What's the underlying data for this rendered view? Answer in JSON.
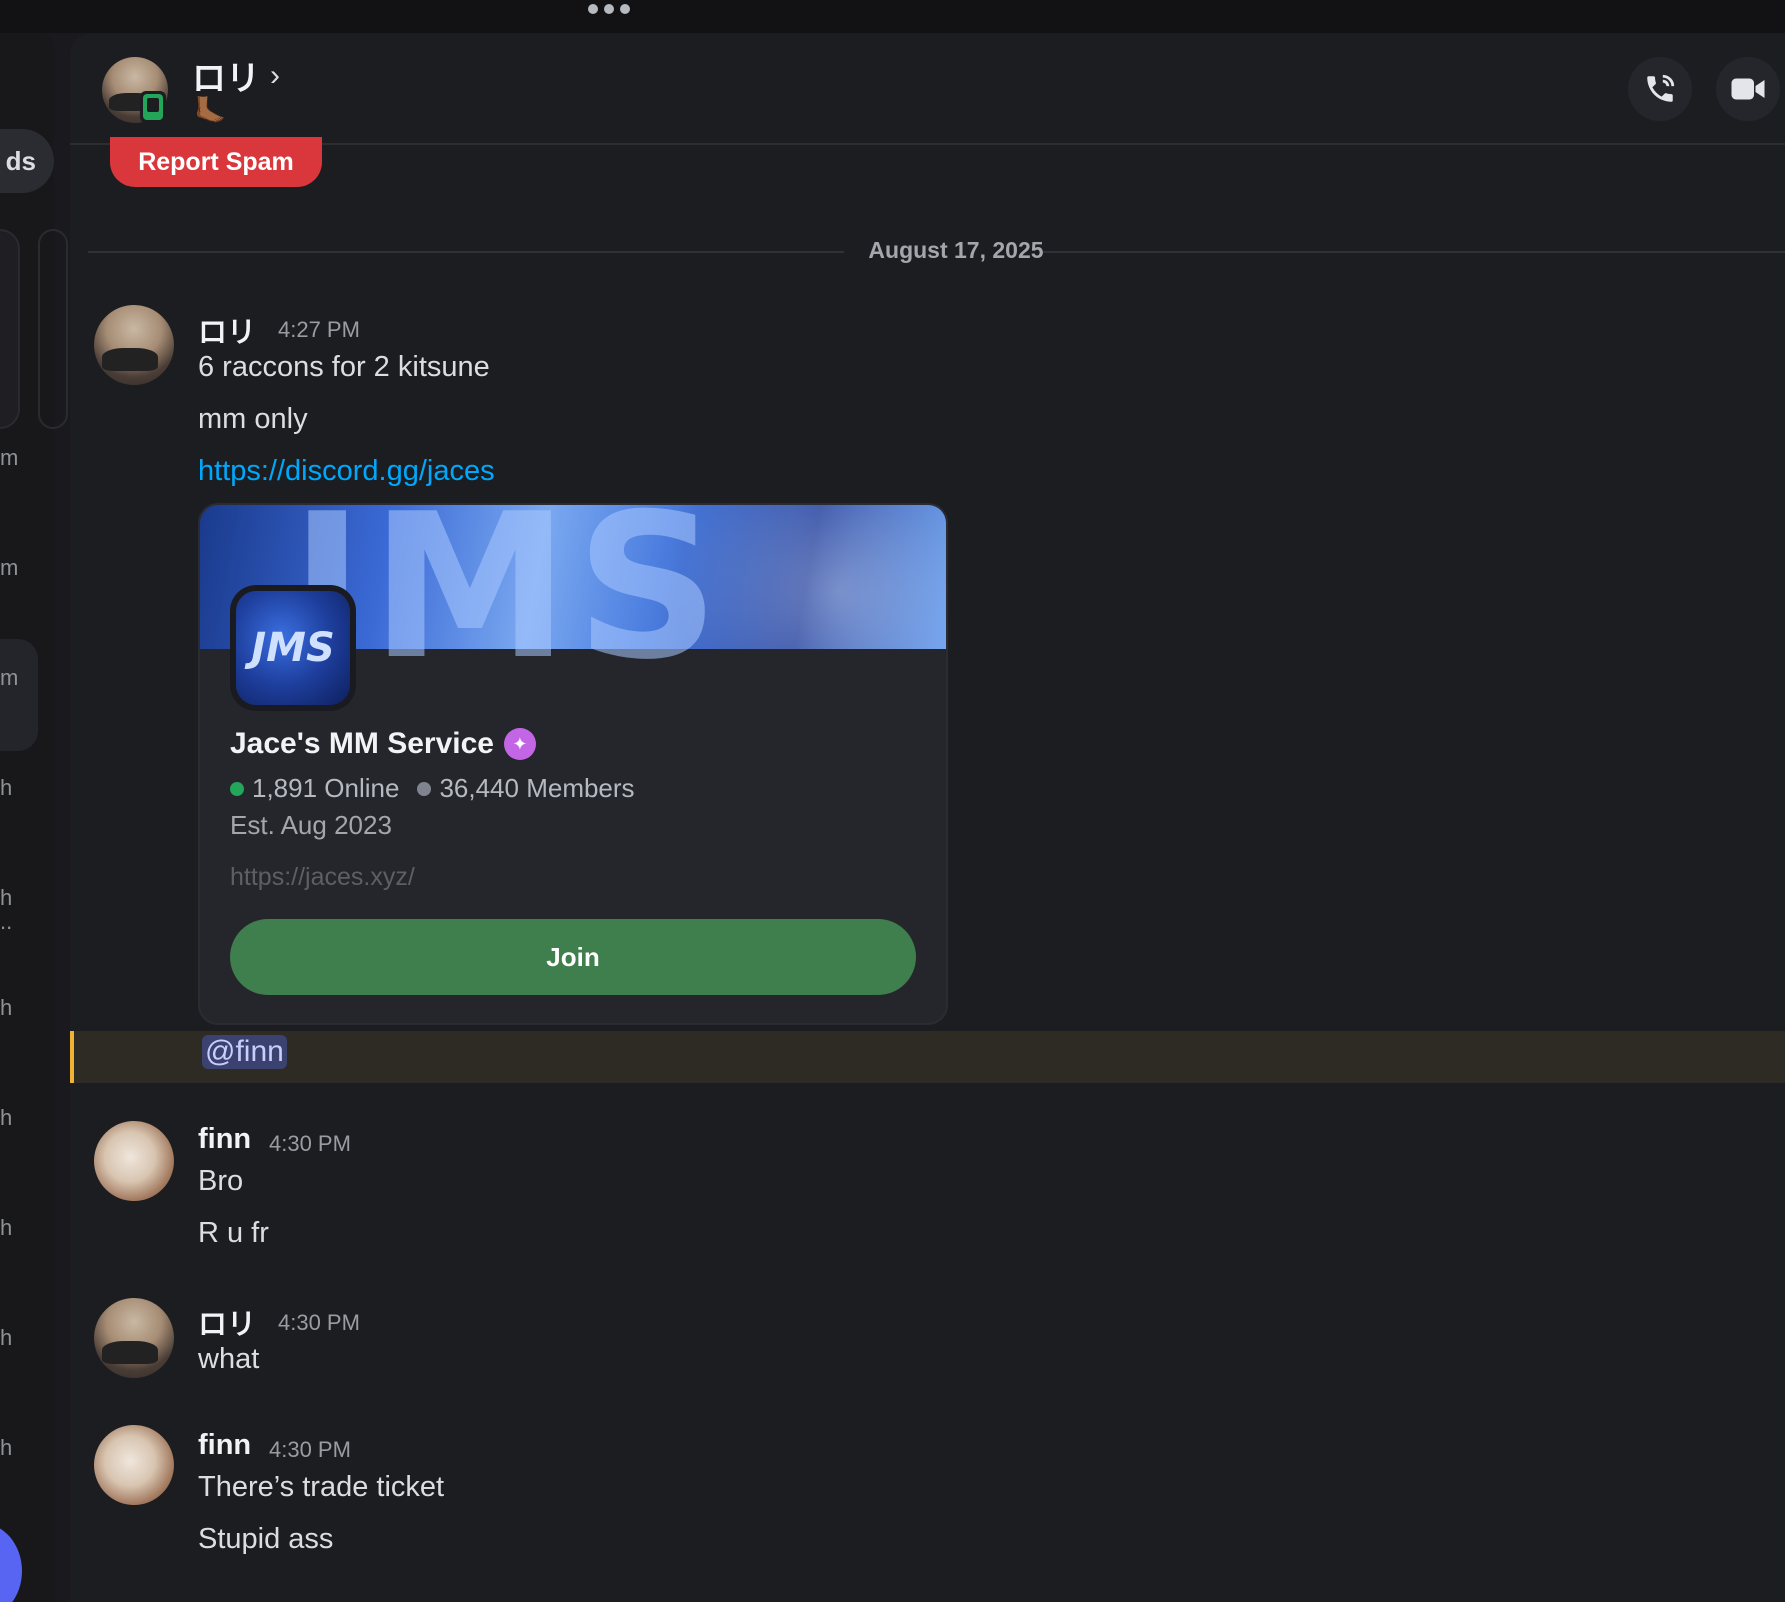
{
  "header": {
    "contact_name": "ロリ",
    "chevron": "›",
    "status_emoji": "🦶🏾",
    "call_icon": "phone-call-icon",
    "video_icon": "video-camera-icon"
  },
  "rail": {
    "pill_label": "ds",
    "letters": [
      "m",
      "m",
      "m",
      "h",
      "h",
      "..",
      "h",
      "h",
      "h",
      "h",
      "h"
    ]
  },
  "report_spam_label": "Report Spam",
  "date_divider": "August 17, 2025",
  "messages": [
    {
      "author": "ロリ",
      "time": "4:27 PM",
      "lines": [
        "6 raccons for 2 kitsune",
        "mm only"
      ],
      "link": "https://discord.gg/jaces"
    },
    {
      "author": "finn",
      "time": "4:30 PM",
      "lines": [
        "Bro",
        "R u fr"
      ]
    },
    {
      "author": "ロリ",
      "time": "4:30 PM",
      "lines": [
        "what"
      ]
    },
    {
      "author": "finn",
      "time": "4:30 PM",
      "lines": [
        "There’s trade ticket",
        "Stupid ass"
      ]
    }
  ],
  "invite": {
    "banner_text": "JMS",
    "icon_text": "JMS",
    "server_name": "Jace's MM Service",
    "online": "1,891 Online",
    "members": "36,440 Members",
    "established": "Est. Aug 2023",
    "vanity_url": "https://jaces.xyz/",
    "join_label": "Join",
    "colors": {
      "online": "#23a55a",
      "members": "#80848e",
      "join": "#3e7f4d"
    }
  },
  "mention": "@finn",
  "colors": {
    "report": "#da373c",
    "link": "#00a8fc",
    "mention_bar": "#f0b232"
  }
}
